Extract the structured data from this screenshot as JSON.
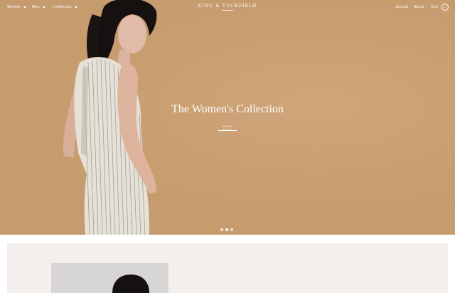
{
  "nav": {
    "left_items": [
      {
        "label": "Women",
        "icon": "chevron-down-icon"
      },
      {
        "label": "Men",
        "icon": "chevron-down-icon"
      },
      {
        "label": "Lookbooks",
        "icon": "chevron-down-icon"
      }
    ],
    "logo": "KING & TUCKFIELD",
    "right_items": [
      {
        "label": "Journal"
      },
      {
        "label": "About"
      },
      {
        "label": "Cart"
      }
    ],
    "cart_count": "0"
  },
  "hero": {
    "title": "The Women's Collection",
    "cta": "SHOP NOW",
    "background_color": "#c69b6e",
    "slides": [
      {
        "active": false
      },
      {
        "active": true
      },
      {
        "active": false
      }
    ]
  },
  "section": {
    "background_color": "#f4efed"
  }
}
